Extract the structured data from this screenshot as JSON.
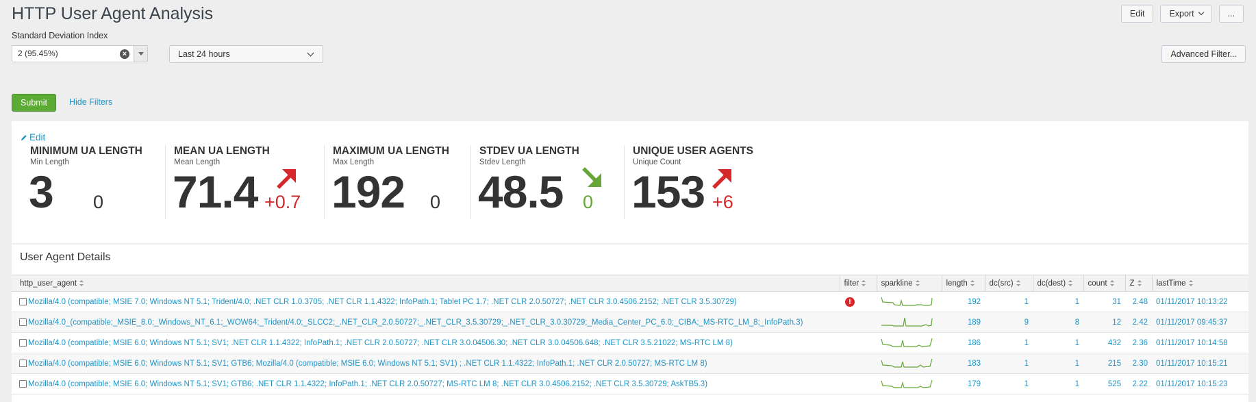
{
  "header": {
    "title": "HTTP User Agent Analysis",
    "edit_label": "Edit",
    "export_label": "Export",
    "more_label": "..."
  },
  "filters": {
    "sd_label": "Standard Deviation Index",
    "sd_value": "2 (95.45%)",
    "time_value": "Last 24 hours",
    "advanced_label": "Advanced Filter...",
    "submit_label": "Submit",
    "hide_label": "Hide Filters"
  },
  "kpis": {
    "edit_label": "Edit",
    "items": [
      {
        "title": "MINIMUM UA LENGTH",
        "subtitle": "Min Length",
        "value": "3",
        "delta": "0",
        "trend": "none",
        "delta_color": "#333333"
      },
      {
        "title": "MEAN UA LENGTH",
        "subtitle": "Mean Length",
        "value": "71.4",
        "delta": "+0.7",
        "trend": "up",
        "delta_color": "#d6292b"
      },
      {
        "title": "MAXIMUM UA LENGTH",
        "subtitle": "Max Length",
        "value": "192",
        "delta": "0",
        "trend": "none",
        "delta_color": "#333333"
      },
      {
        "title": "STDEV UA LENGTH",
        "subtitle": "Stdev Length",
        "value": "48.5",
        "delta": "0",
        "trend": "down",
        "delta_color": "#65a637"
      },
      {
        "title": "UNIQUE USER AGENTS",
        "subtitle": "Unique Count",
        "value": "153",
        "delta": "+6",
        "trend": "up",
        "delta_color": "#d6292b"
      }
    ]
  },
  "details": {
    "title": "User Agent Details",
    "columns": [
      "http_user_agent",
      "filter",
      "sparkline",
      "length",
      "dc(src)",
      "dc(dest)",
      "count",
      "Z",
      "lastTime"
    ],
    "rows": [
      {
        "ua": "Mozilla/4.0 (compatible; MSIE 7.0; Windows NT 5.1; Trident/4.0; .NET CLR 1.0.3705; .NET CLR 1.1.4322; InfoPath.1; Tablet PC 1.7; .NET CLR 2.0.50727; .NET CLR 3.0.4506.2152; .NET CLR 3.5.30729)",
        "filter": "!",
        "length": "192",
        "dc_src": "1",
        "dc_dest": "1",
        "count": "31",
        "z": "2.48",
        "last": "01/11/2017 10:13:22"
      },
      {
        "ua": "Mozilla/4.0_(compatible;_MSIE_8.0;_Windows_NT_6.1;_WOW64;_Trident/4.0;_SLCC2;_.NET_CLR_2.0.50727;_.NET_CLR_3.5.30729;_.NET_CLR_3.0.30729;_Media_Center_PC_6.0;_CIBA;_MS-RTC_LM_8;_InfoPath.3)",
        "filter": "",
        "length": "189",
        "dc_src": "9",
        "dc_dest": "8",
        "count": "12",
        "z": "2.42",
        "last": "01/11/2017 09:45:37"
      },
      {
        "ua": "Mozilla/4.0 (compatible; MSIE 6.0; Windows NT 5.1; SV1; .NET CLR 1.1.4322; InfoPath.1; .NET CLR 2.0.50727; .NET CLR 3.0.04506.30; .NET CLR 3.0.04506.648; .NET CLR 3.5.21022; MS-RTC LM 8)",
        "filter": "",
        "length": "186",
        "dc_src": "1",
        "dc_dest": "1",
        "count": "432",
        "z": "2.36",
        "last": "01/11/2017 10:14:58"
      },
      {
        "ua": "Mozilla/4.0 (compatible; MSIE 6.0; Windows NT 5.1; SV1; GTB6; Mozilla/4.0 (compatible; MSIE 6.0; Windows NT 5.1; SV1) ; .NET CLR 1.1.4322; InfoPath.1; .NET CLR 2.0.50727; MS-RTC LM 8)",
        "filter": "",
        "length": "183",
        "dc_src": "1",
        "dc_dest": "1",
        "count": "215",
        "z": "2.30",
        "last": "01/11/2017 10:15:21"
      },
      {
        "ua": "Mozilla/4.0 (compatible; MSIE 6.0; Windows NT 5.1; SV1; GTB6; .NET CLR 1.1.4322; InfoPath.1; .NET CLR 2.0.50727; MS-RTC LM 8; .NET CLR 3.0.4506.2152; .NET CLR 3.5.30729; AskTB5.3)",
        "filter": "",
        "length": "179",
        "dc_src": "1",
        "dc_dest": "1",
        "count": "525",
        "z": "2.22",
        "last": "01/11/2017 10:15:23"
      }
    ]
  }
}
